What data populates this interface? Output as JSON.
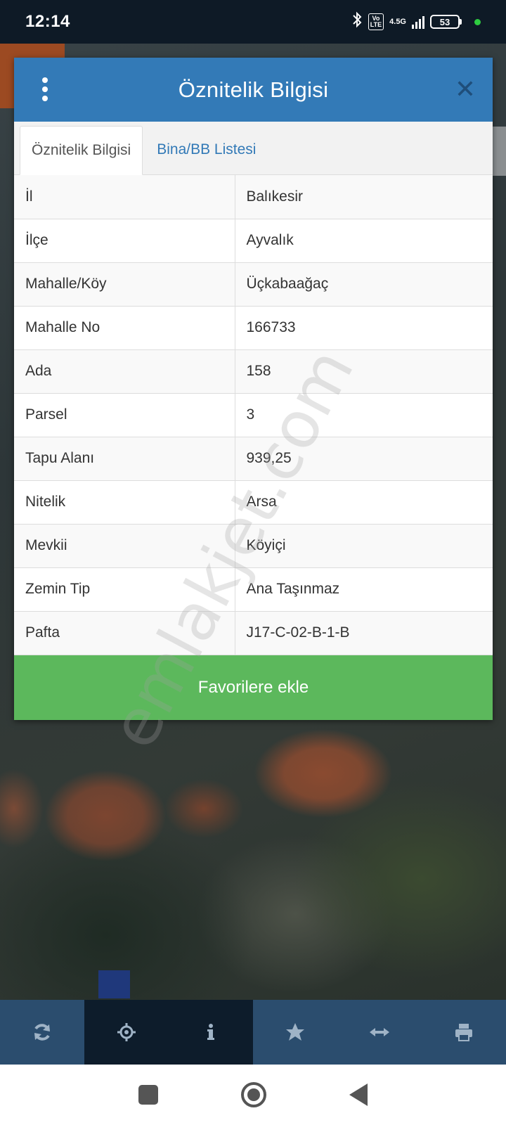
{
  "status_bar": {
    "time": "12:14",
    "volte": "Vo\nLTE",
    "network": "4.5G",
    "battery": "53"
  },
  "dialog": {
    "title": "Öznitelik Bilgisi",
    "tabs": [
      {
        "label": "Öznitelik Bilgisi",
        "active": true
      },
      {
        "label": "Bina/BB Listesi",
        "active": false
      }
    ],
    "rows": [
      {
        "key": "İl",
        "value": "Balıkesir"
      },
      {
        "key": "İlçe",
        "value": "Ayvalık"
      },
      {
        "key": "Mahalle/Köy",
        "value": "Üçkabaağaç"
      },
      {
        "key": "Mahalle No",
        "value": "166733"
      },
      {
        "key": "Ada",
        "value": "158"
      },
      {
        "key": "Parsel",
        "value": "3"
      },
      {
        "key": "Tapu Alanı",
        "value": "939,25"
      },
      {
        "key": "Nitelik",
        "value": "Arsa"
      },
      {
        "key": "Mevkii",
        "value": "Köyiçi"
      },
      {
        "key": "Zemin Tip",
        "value": "Ana Taşınmaz"
      },
      {
        "key": "Pafta",
        "value": "J17-C-02-B-1-B"
      }
    ],
    "favorite_button": "Favorilere ekle"
  },
  "watermark": "emlakjet.com",
  "toolbar": {
    "items": [
      "refresh-icon",
      "crosshair-icon",
      "info-icon",
      "star-icon",
      "measure-icon",
      "print-icon"
    ],
    "active_index": 1
  },
  "colors": {
    "header_blue": "#337ab7",
    "favorite_green": "#5cb85c",
    "toolbar_blue": "#2b4d6e",
    "toolbar_active": "#0d1c2b"
  }
}
